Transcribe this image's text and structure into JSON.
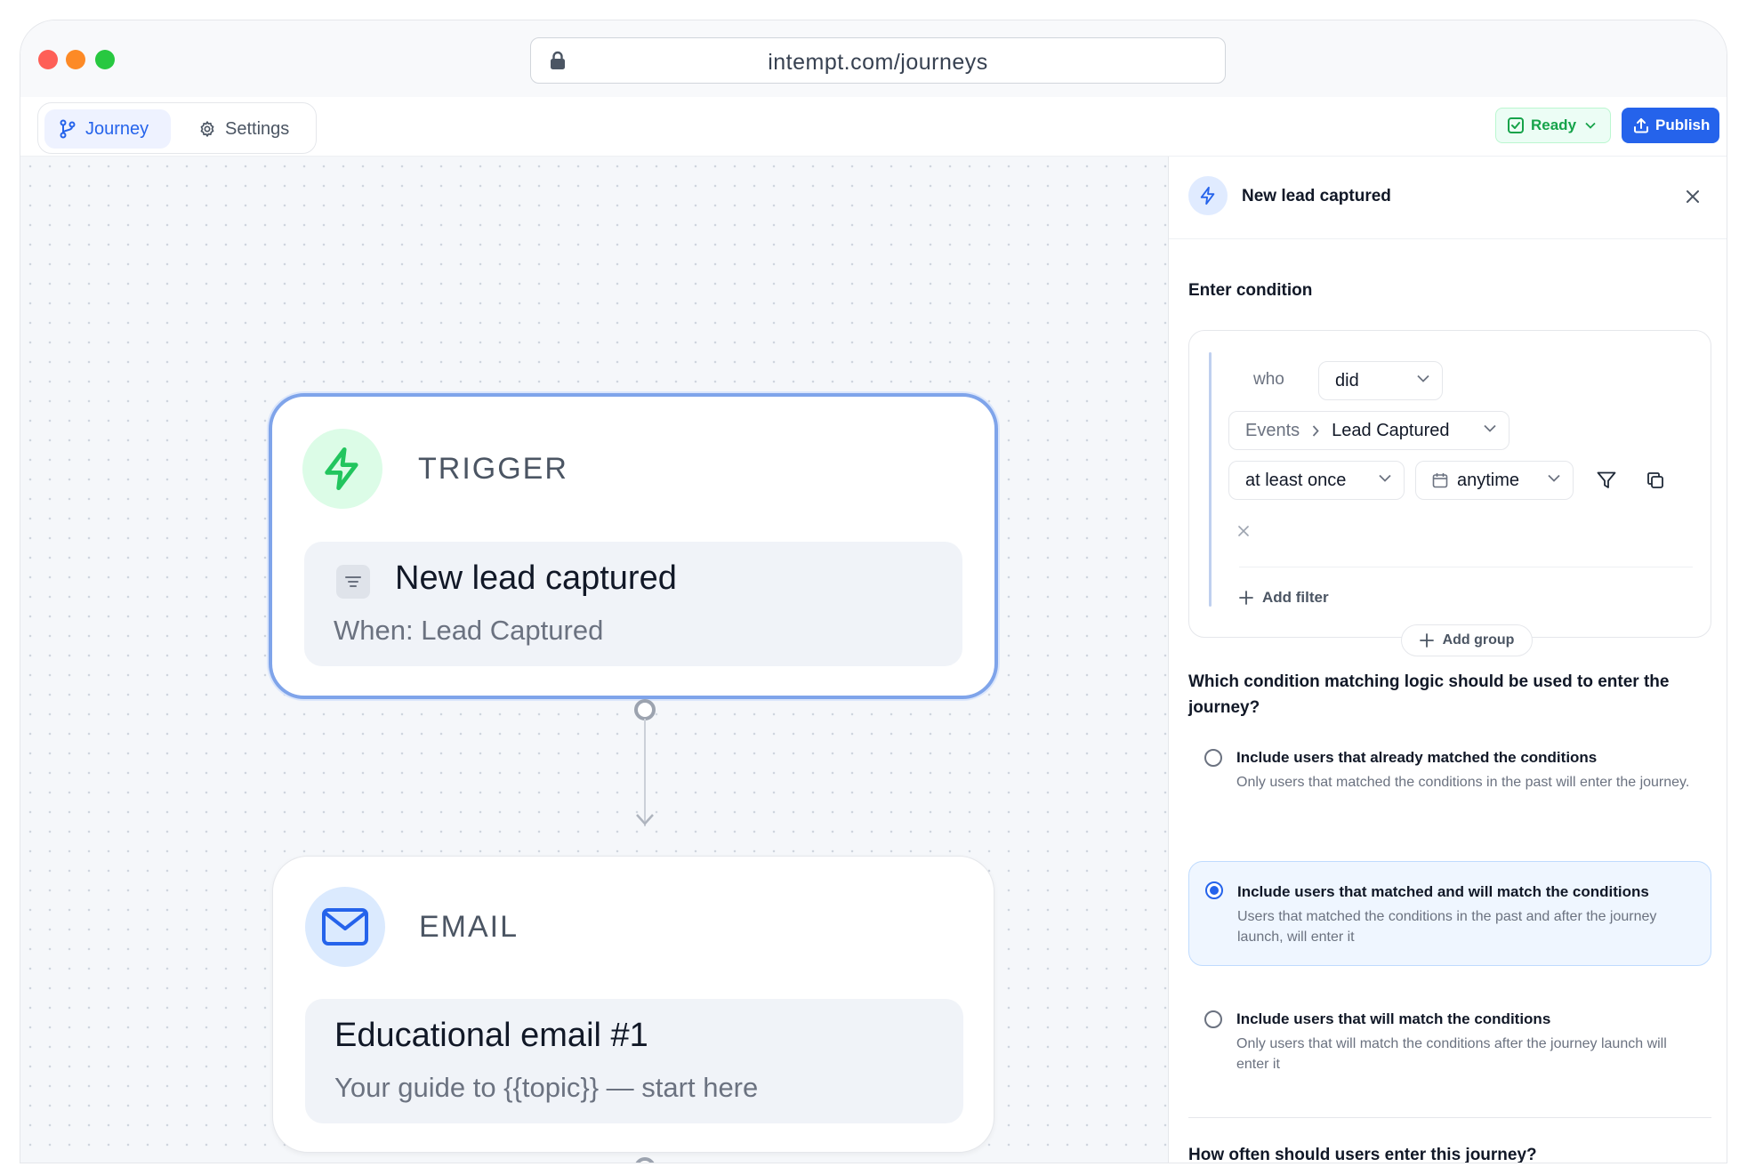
{
  "browser": {
    "url": "intempt.com/journeys"
  },
  "topbar": {
    "tabs": [
      {
        "label": "Journey"
      },
      {
        "label": "Settings"
      }
    ],
    "status_label": "Ready",
    "publish_label": "Publish"
  },
  "canvas": {
    "trigger_node": {
      "type_label": "TRIGGER",
      "title": "New lead captured",
      "subtitle": "When: Lead Captured"
    },
    "email_node": {
      "type_label": "EMAIL",
      "title": "Educational email #1",
      "subtitle": "Your guide to {{topic}} — start here"
    }
  },
  "panel": {
    "title": "New lead captured",
    "enter_condition_label": "Enter condition",
    "condition": {
      "who_label": "who",
      "did_value": "did",
      "events_label": "Events",
      "event_value": "Lead Captured",
      "frequency_value": "at least once",
      "time_value": "anytime",
      "add_filter_label": "Add filter",
      "add_group_label": "Add group"
    },
    "logic_question": "Which condition matching logic should be used to enter the journey?",
    "options": [
      {
        "title": "Include users that already matched the conditions",
        "description": "Only users that matched the conditions in the past will enter the journey.",
        "selected": false
      },
      {
        "title": "Include users that matched and will match the conditions",
        "description": "Users that matched the conditions in the past and after the journey launch, will enter it",
        "selected": true
      },
      {
        "title": "Include users that will match the conditions",
        "description": "Only users that will match the conditions after the journey launch will enter it",
        "selected": false
      }
    ],
    "frequency_question": "How often should users enter this journey?"
  },
  "colors": {
    "accent": "#2563eb",
    "ready_green": "#16a34a",
    "trigger_border": "#7fa4ea"
  }
}
